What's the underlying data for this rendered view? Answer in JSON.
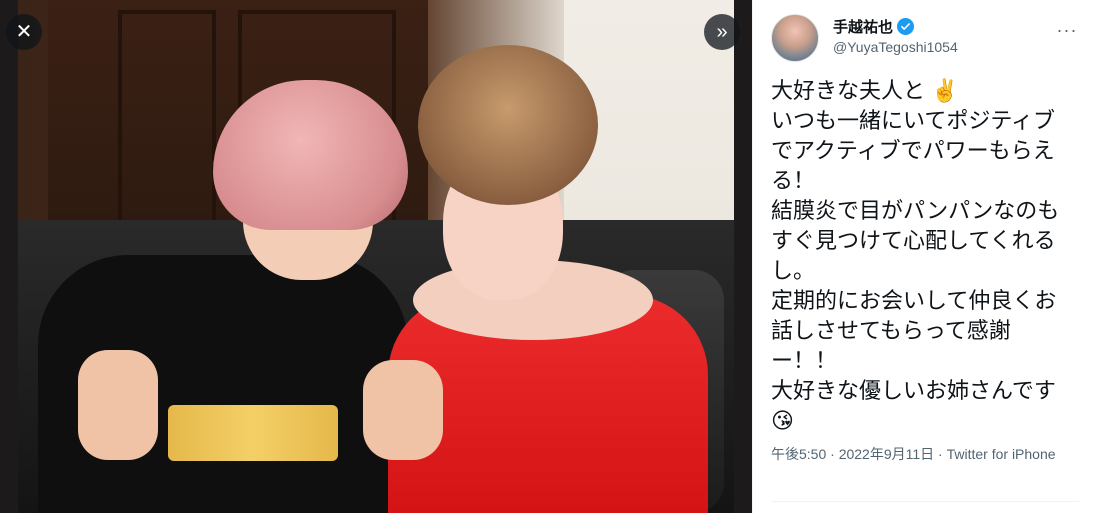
{
  "viewer": {
    "close_icon": "close-icon",
    "next_icon": "chevron-double-right-icon",
    "close_glyph": "✕",
    "next_glyph": "»"
  },
  "tweet": {
    "author_name": "手越祐也",
    "author_handle": "@YuyaTegoshi1054",
    "verified": true,
    "text": "大好きな夫人と ✌️\nいつも一緒にいてポジティブでアクティブでパワーもらえる！\n結膜炎で目がパンパンなのもすぐ見つけて心配してくれるし。\n定期的にお会いして仲良くお話しさせてもらって感謝ー！！\n大好きな優しいお姉さんです😘",
    "timestamp": "午後5:50 · 2022年9月11日 · Twitter for iPhone",
    "more_glyph": "···"
  },
  "colors": {
    "accent": "#1d9bf0",
    "text": "#0f1419",
    "muted": "#536471",
    "viewer_bg": "#1c1a1a"
  }
}
